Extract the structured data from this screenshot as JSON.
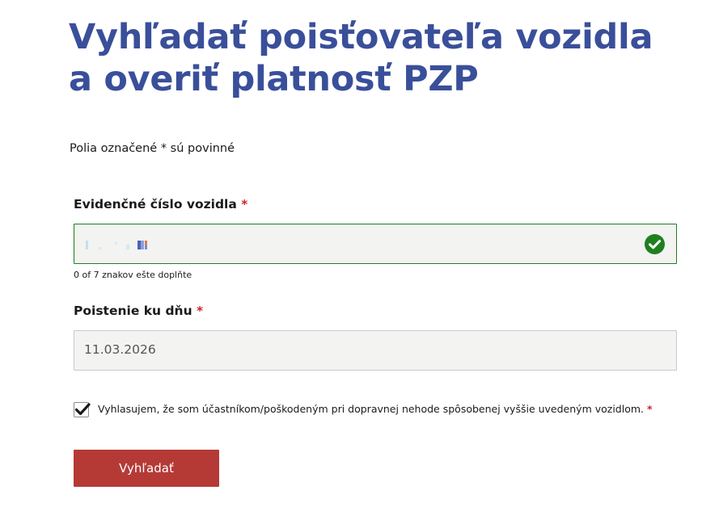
{
  "page": {
    "title": "Vyhľadať poisťovateľa vozidla a overiť platnosť PZP",
    "required_note": "Polia označené * sú povinné"
  },
  "form": {
    "plate_field": {
      "label": "Evidenčné číslo vozidla",
      "required_marker": "*",
      "status_icon": "check-circle-icon",
      "valid": true,
      "counter_text": "0 of 7 znakov ešte doplňte"
    },
    "date_field": {
      "label": "Poistenie ku dňu",
      "required_marker": "*",
      "value": "11.03.2026"
    },
    "consent": {
      "checked": true,
      "text": "Vyhlasujem, že som účastníkom/poškodeným pri dopravnej nehode spôsobenej vyššie uvedeným vozidlom.",
      "required_marker": "*"
    },
    "submit_label": "Vyhľadať"
  },
  "colors": {
    "title": "#3a4f9a",
    "required": "#c62828",
    "valid_border": "#1e7d1e",
    "valid_icon": "#1f7f1f",
    "button": "#b53a36",
    "input_bg": "#f3f3f1"
  }
}
